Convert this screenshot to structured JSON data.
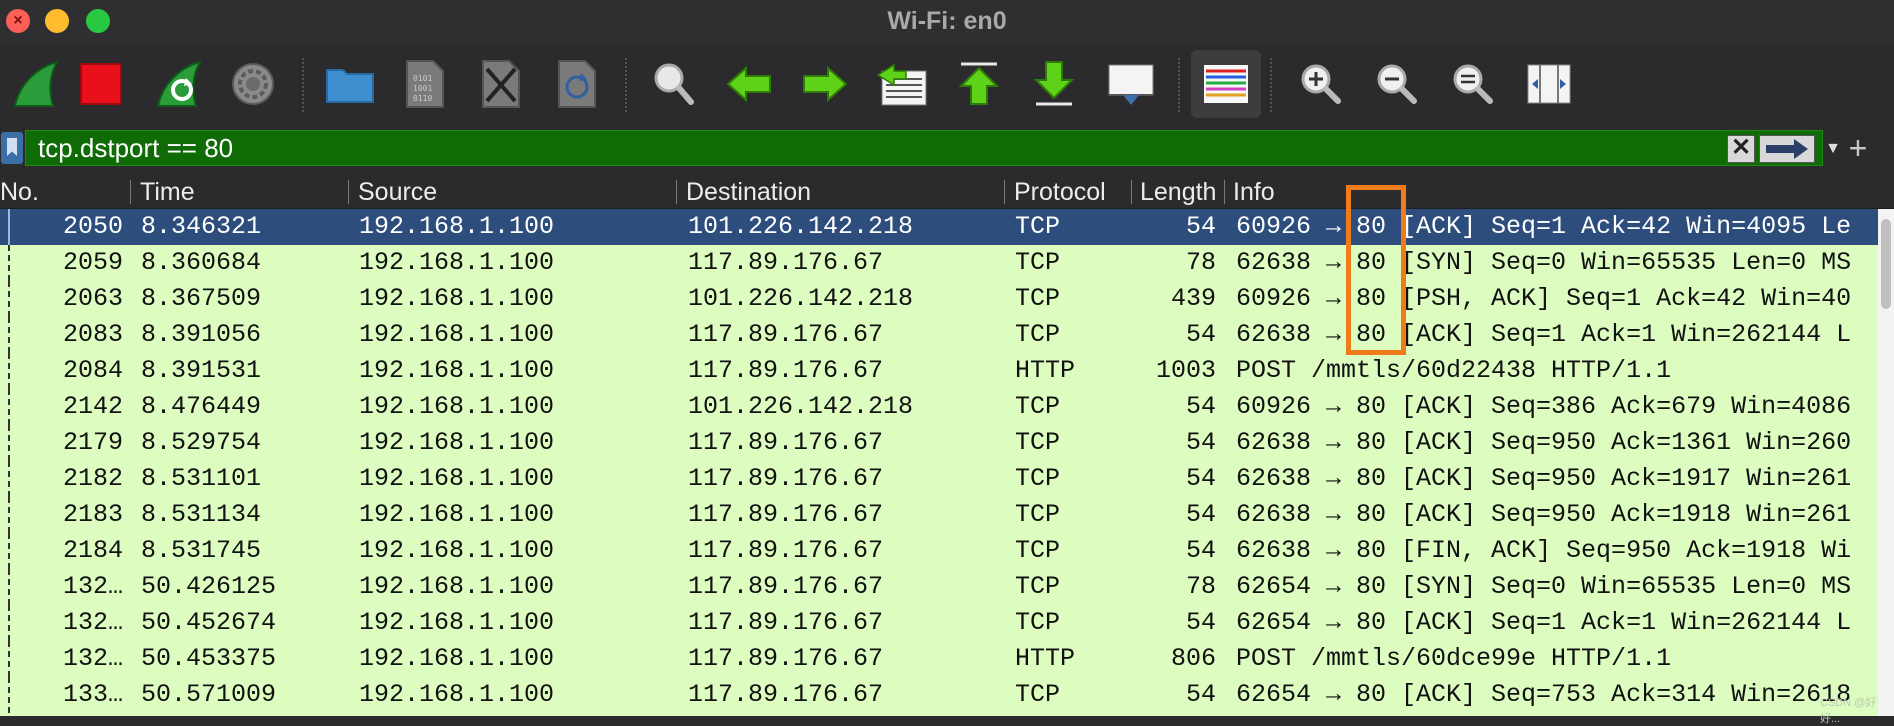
{
  "window": {
    "title": "Wi-Fi: en0"
  },
  "toolbar": {
    "buttons": [
      {
        "name": "start-capture",
        "icon": "shark-fin-icon"
      },
      {
        "name": "stop-capture",
        "icon": "stop-icon"
      },
      {
        "name": "restart-capture",
        "icon": "restart-fin-icon"
      },
      {
        "name": "capture-options",
        "icon": "gear-icon"
      },
      {
        "name": "open-file",
        "icon": "folder-icon"
      },
      {
        "name": "save-file",
        "icon": "binary-file-icon"
      },
      {
        "name": "close-file",
        "icon": "close-file-icon"
      },
      {
        "name": "reload-file",
        "icon": "reload-file-icon"
      },
      {
        "name": "find-packet",
        "icon": "magnifier-icon"
      },
      {
        "name": "go-back",
        "icon": "arrow-left-icon"
      },
      {
        "name": "go-forward",
        "icon": "arrow-right-icon"
      },
      {
        "name": "go-to-packet",
        "icon": "goto-packet-icon"
      },
      {
        "name": "go-first",
        "icon": "arrow-up-bar-icon"
      },
      {
        "name": "go-last",
        "icon": "arrow-down-bar-icon"
      },
      {
        "name": "autoscroll",
        "icon": "autoscroll-icon"
      },
      {
        "name": "colorize",
        "icon": "colorize-lines-icon"
      },
      {
        "name": "zoom-in",
        "icon": "zoom-in-icon"
      },
      {
        "name": "zoom-out",
        "icon": "zoom-out-icon"
      },
      {
        "name": "zoom-normal",
        "icon": "zoom-normal-icon"
      },
      {
        "name": "resize-columns",
        "icon": "resize-columns-icon"
      }
    ]
  },
  "filter": {
    "value": "tcp.dstport == 80"
  },
  "columns": [
    "No.",
    "Time",
    "Source",
    "Destination",
    "Protocol",
    "Length",
    "Info"
  ],
  "packets": [
    {
      "no": "2050",
      "time": "8.346321",
      "src": "192.168.1.100",
      "dst": "101.226.142.218",
      "proto": "TCP",
      "len": "54",
      "info": "60926 → 80 [ACK] Seq=1 Ack=42 Win=4095 Le"
    },
    {
      "no": "2059",
      "time": "8.360684",
      "src": "192.168.1.100",
      "dst": "117.89.176.67",
      "proto": "TCP",
      "len": "78",
      "info": "62638 → 80 [SYN] Seq=0 Win=65535 Len=0 MS"
    },
    {
      "no": "2063",
      "time": "8.367509",
      "src": "192.168.1.100",
      "dst": "101.226.142.218",
      "proto": "TCP",
      "len": "439",
      "info": "60926 → 80 [PSH, ACK] Seq=1 Ack=42 Win=40"
    },
    {
      "no": "2083",
      "time": "8.391056",
      "src": "192.168.1.100",
      "dst": "117.89.176.67",
      "proto": "TCP",
      "len": "54",
      "info": "62638 → 80 [ACK] Seq=1 Ack=1 Win=262144 L"
    },
    {
      "no": "2084",
      "time": "8.391531",
      "src": "192.168.1.100",
      "dst": "117.89.176.67",
      "proto": "HTTP",
      "len": "1003",
      "info": "POST /mmtls/60d22438 HTTP/1.1"
    },
    {
      "no": "2142",
      "time": "8.476449",
      "src": "192.168.1.100",
      "dst": "101.226.142.218",
      "proto": "TCP",
      "len": "54",
      "info": "60926 → 80 [ACK] Seq=386 Ack=679 Win=4086"
    },
    {
      "no": "2179",
      "time": "8.529754",
      "src": "192.168.1.100",
      "dst": "117.89.176.67",
      "proto": "TCP",
      "len": "54",
      "info": "62638 → 80 [ACK] Seq=950 Ack=1361 Win=260"
    },
    {
      "no": "2182",
      "time": "8.531101",
      "src": "192.168.1.100",
      "dst": "117.89.176.67",
      "proto": "TCP",
      "len": "54",
      "info": "62638 → 80 [ACK] Seq=950 Ack=1917 Win=261"
    },
    {
      "no": "2183",
      "time": "8.531134",
      "src": "192.168.1.100",
      "dst": "117.89.176.67",
      "proto": "TCP",
      "len": "54",
      "info": "62638 → 80 [ACK] Seq=950 Ack=1918 Win=261"
    },
    {
      "no": "2184",
      "time": "8.531745",
      "src": "192.168.1.100",
      "dst": "117.89.176.67",
      "proto": "TCP",
      "len": "54",
      "info": "62638 → 80 [FIN, ACK] Seq=950 Ack=1918 Wi"
    },
    {
      "no": "132…",
      "time": "50.426125",
      "src": "192.168.1.100",
      "dst": "117.89.176.67",
      "proto": "TCP",
      "len": "78",
      "info": "62654 → 80 [SYN] Seq=0 Win=65535 Len=0 MS"
    },
    {
      "no": "132…",
      "time": "50.452674",
      "src": "192.168.1.100",
      "dst": "117.89.176.67",
      "proto": "TCP",
      "len": "54",
      "info": "62654 → 80 [ACK] Seq=1 Ack=1 Win=262144 L"
    },
    {
      "no": "132…",
      "time": "50.453375",
      "src": "192.168.1.100",
      "dst": "117.89.176.67",
      "proto": "HTTP",
      "len": "806",
      "info": "POST /mmtls/60dce99e HTTP/1.1"
    },
    {
      "no": "133…",
      "time": "50.571009",
      "src": "192.168.1.100",
      "dst": "117.89.176.67",
      "proto": "TCP",
      "len": "54",
      "info": "62654 → 80 [ACK] Seq=753 Ack=314 Win=2618"
    }
  ],
  "selected_index": 0,
  "colors": {
    "row_bg": "#dcfcc0",
    "selected_bg": "#2d4d7c",
    "filter_bg": "#0f6b06",
    "highlight_box": "#f07b1a"
  },
  "watermark": "CSDN @好好..."
}
